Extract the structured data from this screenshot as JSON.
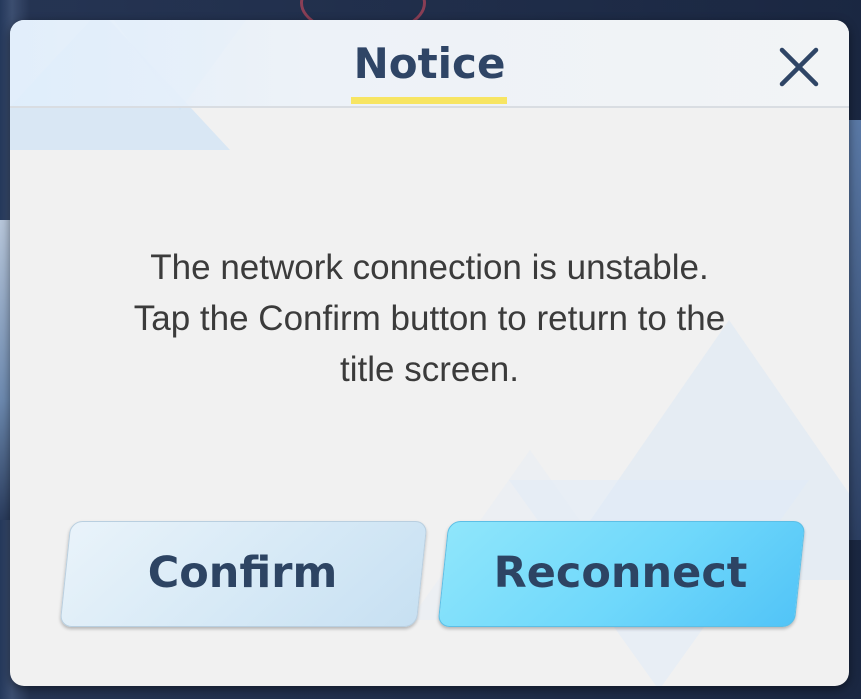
{
  "dialog": {
    "title": "Notice",
    "close_icon": "close-icon",
    "message_lines": [
      "The network connection is unstable.",
      "Tap the Confirm button to return to the",
      "title screen."
    ],
    "buttons": {
      "confirm_label": "Confirm",
      "reconnect_label": "Reconnect"
    }
  },
  "colors": {
    "title_text": "#2f4566",
    "title_underline": "#f7e563",
    "confirm_button": "#d6e9f6",
    "reconnect_button": "#6fd8fb",
    "dialog_background": "#f1f1f1"
  }
}
